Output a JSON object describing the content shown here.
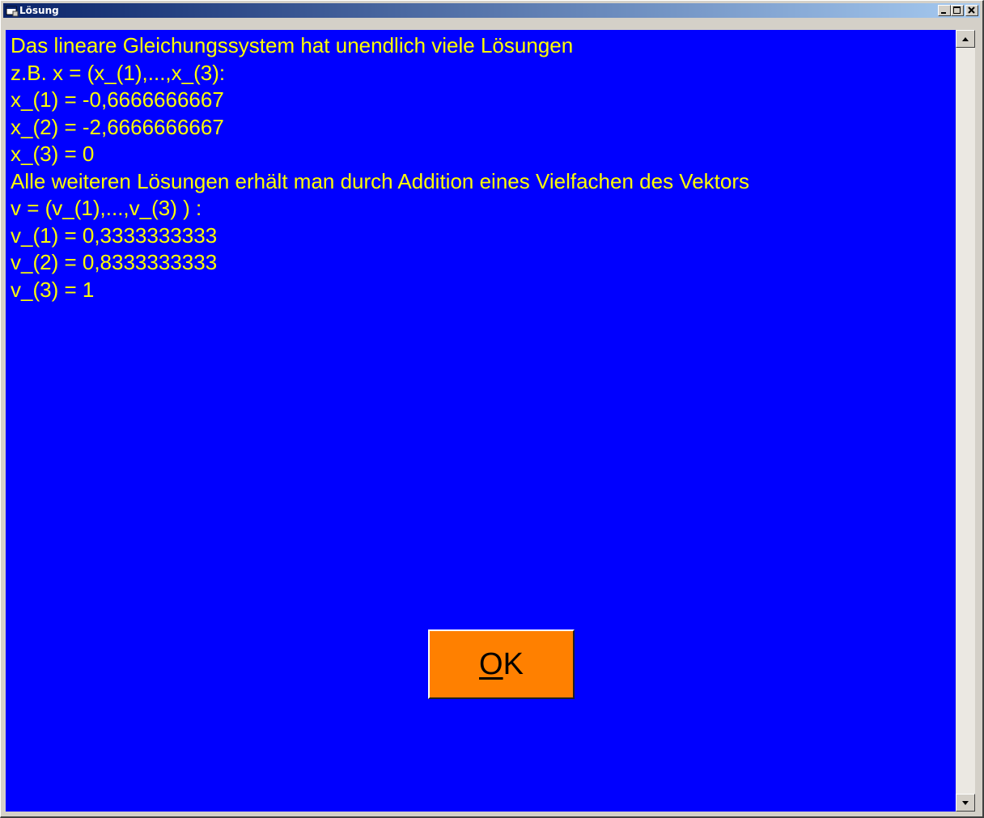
{
  "window": {
    "title": "Lösung",
    "icon": "app-window-icon",
    "controls": [
      "minimize-icon",
      "maximize-icon",
      "close-icon"
    ]
  },
  "results": {
    "lines": [
      "Das lineare Gleichungssystem hat unendlich viele Lösungen",
      "z.B. x = (x_(1),...,x_(3):",
      "x_(1) = -0,6666666667",
      "x_(2) = -2,6666666667",
      "x_(3) = 0",
      "Alle weiteren Lösungen erhält man durch Addition eines Vielfachen des Vektors",
      "v = (v_(1),...,v_(3) ) :",
      "v_(1) = 0,3333333333",
      "v_(2) = 0,8333333333",
      "v_(3) = 1"
    ]
  },
  "ok_button": {
    "accel_char": "O",
    "rest": "K"
  },
  "colors": {
    "background": "#0000ff",
    "text": "#ffff00",
    "button": "#ff8000",
    "titlebar_start": "#0a246a",
    "titlebar_end": "#a6caf0"
  }
}
